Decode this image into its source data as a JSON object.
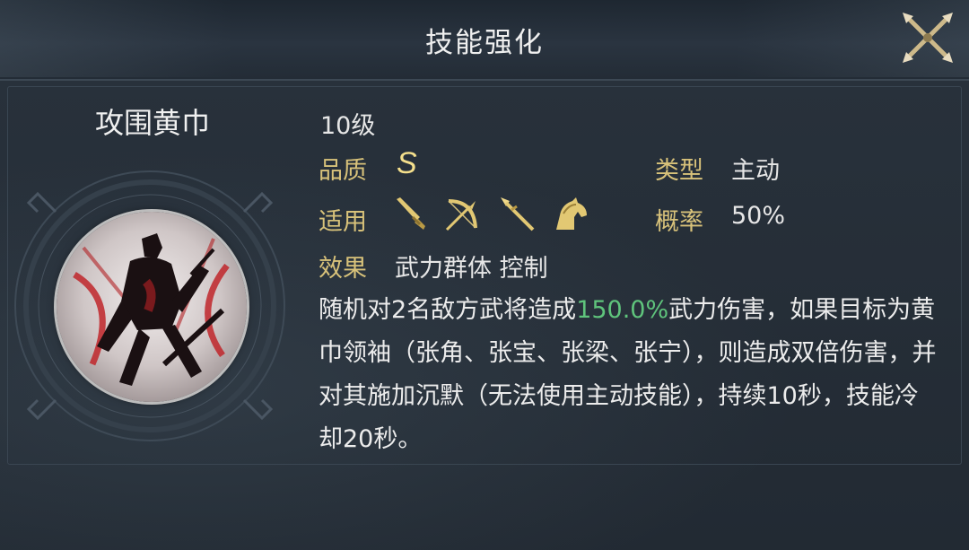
{
  "header": {
    "title": "技能强化"
  },
  "skill": {
    "name": "攻围黄巾",
    "level": "10级",
    "quality_label": "品质",
    "quality_value": "S",
    "type_label": "类型",
    "type_value": "主动",
    "applicable_label": "适用",
    "applicable_icons": [
      "sword-icon",
      "bow-icon",
      "spear-icon",
      "horse-icon"
    ],
    "probability_label": "概率",
    "probability_value": "50%",
    "effect_label": "效果",
    "effect_value": "武力群体 控制",
    "description": {
      "part1": "随机对2名敌方武将造成",
      "highlight": "150.0%",
      "part2": "武力伤害，如果目标为黄巾领袖（张角、张宝、张梁、张宁），则造成双倍伤害，并对其施加沉默（无法使用主动技能），持续10秒，技能冷却20秒。"
    }
  },
  "colors": {
    "label": "#d8c27a",
    "highlight": "#5fc47c",
    "quality": "#f4df8c",
    "background": "#242c35"
  }
}
